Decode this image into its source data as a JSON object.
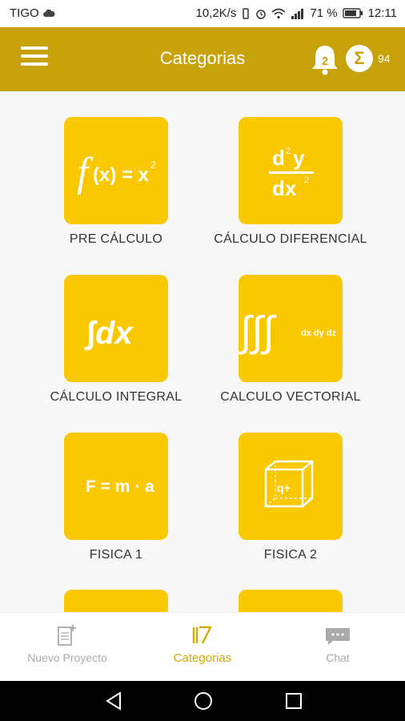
{
  "status": {
    "carrier": "TIGO",
    "speed": "10,2K/s",
    "battery": "71 %",
    "time": "12:11"
  },
  "app_bar": {
    "title": "Categorias",
    "notifications": "2",
    "points": "94",
    "sigma": "Σ"
  },
  "categories": [
    {
      "label": "PRE CÁLCULO",
      "icon": "function-x-squared-icon"
    },
    {
      "label": "CÁLCULO DIFERENCIAL",
      "icon": "second-derivative-icon"
    },
    {
      "label": "CÁLCULO INTEGRAL",
      "icon": "integral-dx-icon"
    },
    {
      "label": "CALCULO VECTORIAL",
      "icon": "triple-integral-icon"
    },
    {
      "label": "FISICA 1",
      "icon": "force-mass-acceleration-icon"
    },
    {
      "label": "FISICA 2",
      "icon": "charge-cube-icon"
    }
  ],
  "tile_text": {
    "f": "f",
    "fx": "(x) = x",
    "sq": "2",
    "d2y": "d",
    "y": "y",
    "dx2": "dx",
    "integral": "∫dx",
    "triple": "∫∫∫",
    "dxdydz": "dx dy dz",
    "fma": "F = m · a",
    "q": "q+"
  },
  "bottom_nav": [
    {
      "label": "Nuevo Proyecto",
      "icon": "new-document-icon"
    },
    {
      "label": "Categorias",
      "icon": "categories-icon"
    },
    {
      "label": "Chat",
      "icon": "chat-icon"
    }
  ],
  "colors": {
    "app_bar": "#c8a20a",
    "tile": "#f9c800",
    "active_nav": "#d4a900"
  }
}
